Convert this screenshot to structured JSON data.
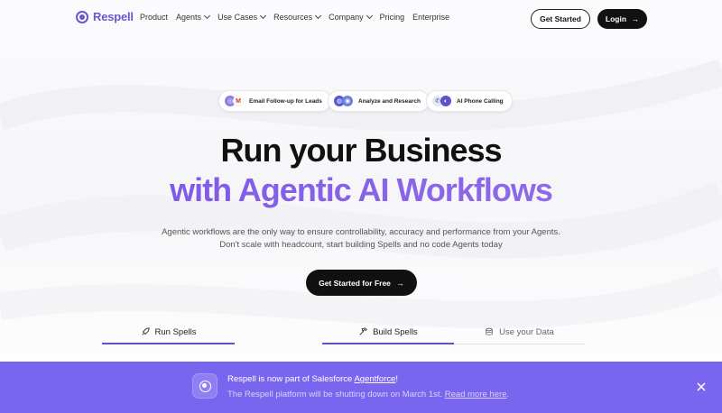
{
  "colors": {
    "brand": "#6e56cf",
    "accent_gradient_start": "#7a52e6",
    "banner_bg": "#7a66ee",
    "cta_bg": "#111111"
  },
  "nav": {
    "logo": "Respell",
    "links": [
      {
        "label": "Product",
        "dropdown": false
      },
      {
        "label": "Agents",
        "dropdown": true
      },
      {
        "label": "Use Cases",
        "dropdown": true
      },
      {
        "label": "Resources",
        "dropdown": true
      },
      {
        "label": "Company",
        "dropdown": true
      },
      {
        "label": "Pricing",
        "dropdown": false
      },
      {
        "label": "Enterprise",
        "dropdown": false
      }
    ],
    "get_started": "Get Started",
    "login": "Login",
    "login_icon": "arrow-right-icon"
  },
  "pills": [
    {
      "label": "Email Follow-up for Leads",
      "icons": [
        "crm-icon",
        "gmail-icon"
      ]
    },
    {
      "label": "Analyze and Research",
      "icons": [
        "globe-icon",
        "research-icon"
      ]
    },
    {
      "label": "AI Phone Calling",
      "icons": [
        "phone-icon",
        "voice-icon"
      ]
    }
  ],
  "hero": {
    "title_line1": "Run your Business",
    "title_line2": "with Agentic AI Workflows",
    "subtitle_line1": "Agentic workflows are the only way to ensure controllability, accuracy and performance from your Agents.",
    "subtitle_line2": "Don't scale with headcount, start building Spells and no code Agents today",
    "cta": "Get Started for Free",
    "cta_icon": "arrow-right-icon"
  },
  "tabs": [
    {
      "label": "Run Spells",
      "icon": "rocket-icon",
      "active": true
    },
    {
      "label": "Build Spells",
      "icon": "hammer-icon",
      "active": true
    },
    {
      "label": "Use your Data",
      "icon": "database-icon",
      "active": false
    }
  ],
  "banner": {
    "line1_prefix": "Respell is now part of Salesforce ",
    "line1_link": "Agentforce",
    "line1_suffix": "!",
    "line2_prefix": "The Respell platform will be shutting down on March 1st. ",
    "line2_link": "Read more here",
    "line2_suffix": ".",
    "close_icon": "close-icon"
  }
}
